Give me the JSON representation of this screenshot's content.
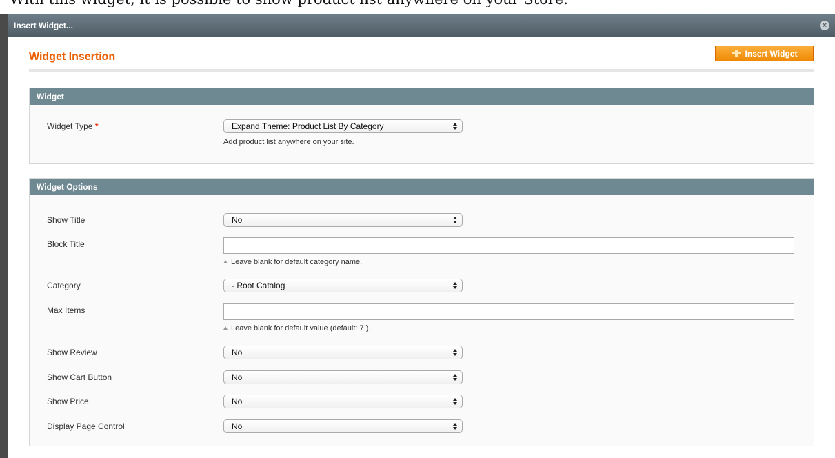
{
  "background_caption": "With this widget, it is possible to show product list anywhere on your Store.",
  "dialog": {
    "title": "Insert Widget...",
    "close_icon": "close-circle-icon"
  },
  "header": {
    "title": "Widget Insertion",
    "insert_button_label": "Insert Widget",
    "insert_icon": "insert-widget-icon"
  },
  "widget_section": {
    "heading": "Widget",
    "type_label": "Widget Type",
    "required_mark": "*",
    "type_value": "Expand Theme: Product List By Category",
    "type_note": "Add product list anywhere on your site."
  },
  "options_section": {
    "heading": "Widget Options",
    "show_title": {
      "label": "Show Title",
      "value": "No"
    },
    "block_title": {
      "label": "Block Title",
      "value": "",
      "note": "Leave blank for default category name."
    },
    "category": {
      "label": "Category",
      "value": "- Root Catalog"
    },
    "max_items": {
      "label": "Max Items",
      "value": "",
      "note": "Leave blank for default value (default: 7.)."
    },
    "show_review": {
      "label": "Show Review",
      "value": "No"
    },
    "show_cart_button": {
      "label": "Show Cart Button",
      "value": "No"
    },
    "show_price": {
      "label": "Show Price",
      "value": "No"
    },
    "display_page_control": {
      "label": "Display Page Control",
      "value": "No"
    }
  },
  "colors": {
    "accent_orange": "#eb5e00",
    "button_orange": "#f39a1e",
    "section_header": "#6f8992",
    "titlebar": "#5c6b74"
  }
}
